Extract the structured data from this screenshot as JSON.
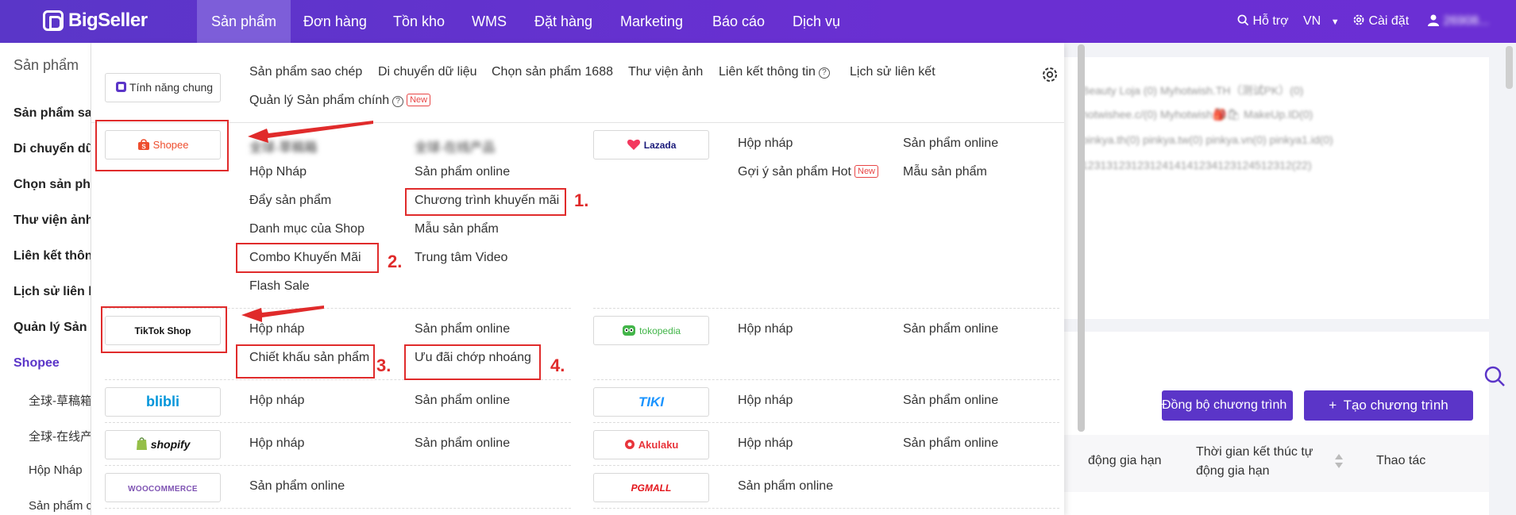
{
  "topbar": {
    "logo": "BigSeller",
    "nav": [
      "Sản phẩm",
      "Đơn hàng",
      "Tồn kho",
      "WMS",
      "Đặt hàng",
      "Marketing",
      "Báo cáo",
      "Dịch vụ"
    ],
    "support": "Hỗ trợ",
    "lang": "VN",
    "settings": "Cài đặt",
    "user": "26908..."
  },
  "sidebar": {
    "title": "Sản phẩm",
    "items": [
      "Sản phẩm sao",
      "Di chuyển dữ l",
      "Chọn sản phẩ",
      "Thư viện ảnh",
      "Liên kết thông",
      "Lịch sử liên kế",
      "Quản lý Sản p",
      "Shopee"
    ],
    "sub": [
      "全球-草稿箱",
      "全球-在线产",
      "Hộp Nháp",
      "Sản phẩm c"
    ]
  },
  "background": {
    "shops": [
      "Beauty Loja (0)    Myhotwish.TH（测试PK）(0)",
      "hotwishee.c/(0)    Myhotwish🎒🛍 MakeUp.ID(0)",
      "pinkya.th(0)    pinkya.tw(0)    pinkya.vn(0)    pinkya1.id(0)",
      "1231312312312414141234123124512312(22)"
    ],
    "sync_btn": "Đồng bộ chương trình",
    "create_btn": "Tạo chương trình",
    "col1": "động gia hạn",
    "col2_line1": "Thời gian kết thúc tự",
    "col2_line2": "động gia hạn",
    "col3": "Thao tác"
  },
  "dropdown": {
    "common": "Tính năng chung",
    "common_links": [
      "Sản phẩm sao chép",
      "Di chuyển dữ liệu",
      "Chọn sản phẩm 1688",
      "Thư viện ảnh",
      "Liên kết thông tin",
      "Lịch sử liên kết"
    ],
    "main_product": "Quản lý Sản phẩm chính",
    "new_badge": "New",
    "help_icon": "?",
    "shopee": {
      "logo": "Shopee",
      "col1": [
        "全球-草稿箱",
        "Hộp Nháp",
        "Đẩy sản phẩm",
        "Danh mục của Shop",
        "Combo Khuyến Mãi",
        "Flash Sale"
      ],
      "col2": [
        "全球-在线产品",
        "Sản phẩm online",
        "Chương trình khuyến mãi",
        "Mẫu sản phẩm",
        "Trung tâm Video"
      ]
    },
    "lazada": {
      "logo": "Lazada",
      "col1": [
        "Hộp nháp",
        "Gợi ý sản phẩm Hot"
      ],
      "col2": [
        "Sản phẩm online",
        "Mẫu sản phẩm"
      ]
    },
    "tiktok": {
      "logo": "TikTok Shop",
      "col1": [
        "Hộp nháp",
        "Chiết khấu sản phẩm"
      ],
      "col2": [
        "Sản phẩm online",
        "Ưu đãi chớp nhoáng"
      ]
    },
    "tokopedia": {
      "logo": "tokopedia",
      "col1": "Hộp nháp",
      "col2": "Sản phẩm online"
    },
    "blibli": {
      "logo": "blibli",
      "col1": "Hộp nháp",
      "col2": "Sản phẩm online"
    },
    "tiki": {
      "logo": "TIKI",
      "col1": "Hộp nháp",
      "col2": "Sản phẩm online"
    },
    "shopify": {
      "logo": "shopify",
      "col1": "Hộp nháp",
      "col2": "Sản phẩm online"
    },
    "akulaku": {
      "logo": "Akulaku",
      "col1": "Hộp nháp",
      "col2": "Sản phẩm online"
    },
    "woocommerce": {
      "logo": "WOOCOMMERCE",
      "col1": "Sản phẩm online"
    },
    "pgmall": {
      "logo": "PGMALL",
      "col1": "Sản phẩm online"
    }
  },
  "annotations": [
    "1.",
    "2.",
    "3.",
    "4."
  ],
  "colors": {
    "brand": "#5b35c8",
    "annotation": "#e02b2b",
    "shopee": "#ee4d2d"
  }
}
